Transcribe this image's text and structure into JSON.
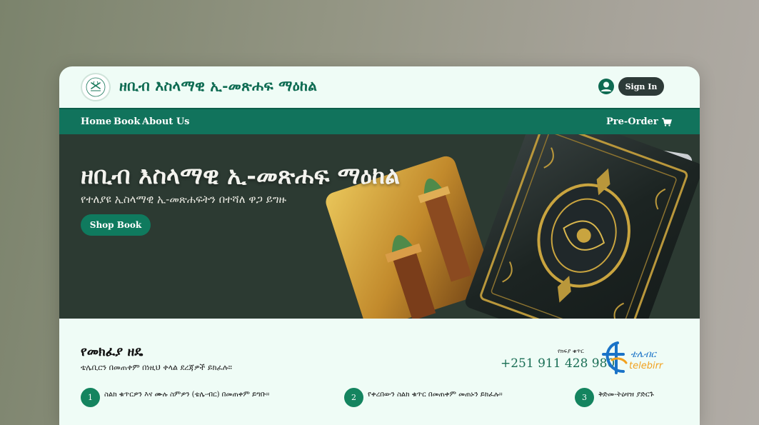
{
  "header": {
    "brand": "ዘቢብ እስላማዊ ኢ-መጽሐፍ ማዕከል",
    "sign_in": "Sign In"
  },
  "nav": {
    "items": [
      {
        "label": "Home"
      },
      {
        "label": "Book"
      },
      {
        "label": "About Us"
      }
    ],
    "preorder": "Pre-Order"
  },
  "hero": {
    "title": "ዘቢብ እስላማዊ ኢ-መጽሐፍ ማዕከል",
    "subtitle": "የተለያዩ ኢስላማዊ ኢ-መጽሐፍትን በተሻለ ዋጋ ይግዙ",
    "button": "Shop Book"
  },
  "payment": {
    "title": "የመክፈያ ዘዴ",
    "description": "ቴሌቢርን በመጠቀም በነዚህ ቀላል ደረጃዎች ይክፈሉ።",
    "phone_label": "የክፍያ ቁጥር",
    "phone": "+251 911 428 980",
    "provider_amharic": "ቴሌብር",
    "provider_name": "telebirr",
    "steps": [
      {
        "num": "1",
        "text": "ስልክ ቁጥርዎን እና ሙሉ ስምዎን (ቴሌ-ብር) በመጠቀም ይግቡ።"
      },
      {
        "num": "2",
        "text": "የቀረበውን ስልክ ቁጥር በመጠቀም መጠኑን ይክፈሉ።"
      },
      {
        "num": "3",
        "text": "ቅድመ-ትዕዛዝ ያድርጉ"
      }
    ]
  },
  "colors": {
    "brand_green": "#0e6b52",
    "nav_green": "#11735c",
    "card_bg": "#effcf6",
    "hero_bg": "#2c3a32"
  }
}
